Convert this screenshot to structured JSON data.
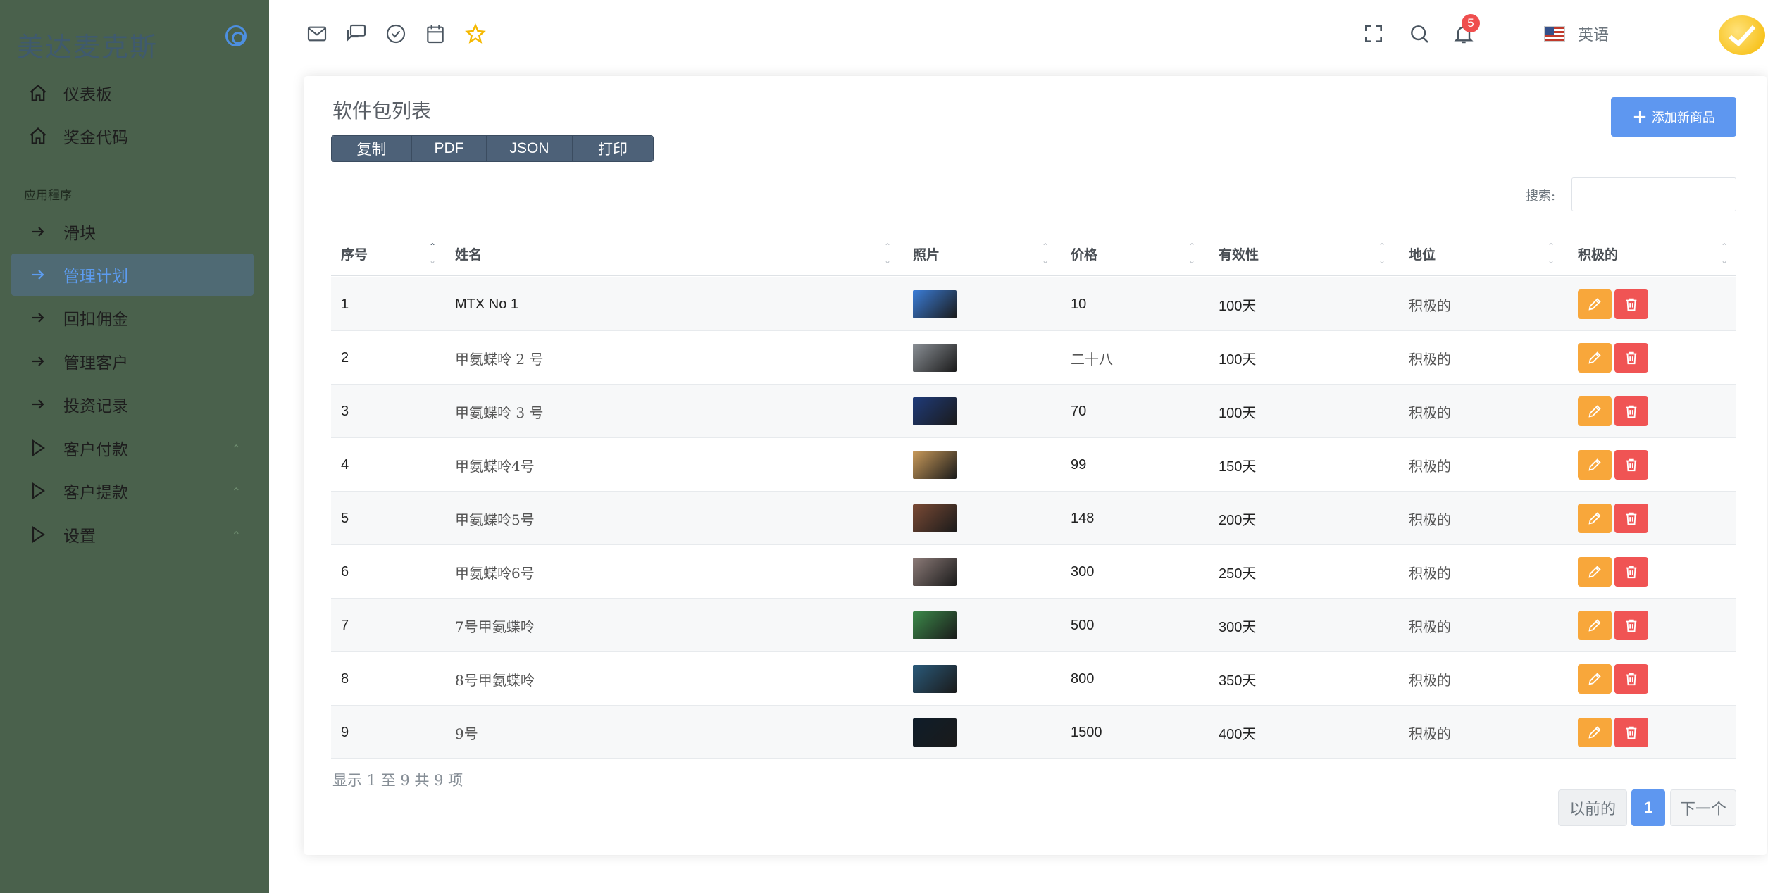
{
  "brand": {
    "name": "美达麦克斯"
  },
  "sidebar": {
    "items_top": [
      {
        "label": "仪表板",
        "icon": "home-icon"
      },
      {
        "label": "奖金代码",
        "icon": "home-icon"
      }
    ],
    "section_label": "应用程序",
    "items": [
      {
        "label": "滑块",
        "icon": "arrow-right-icon"
      },
      {
        "label": "管理计划",
        "icon": "arrow-right-icon",
        "active": true
      },
      {
        "label": "回扣佣金",
        "icon": "arrow-right-icon"
      },
      {
        "label": "管理客户",
        "icon": "arrow-right-icon"
      },
      {
        "label": "投资记录",
        "icon": "arrow-right-icon"
      },
      {
        "label": "客户付款",
        "icon": "play-icon",
        "expandable": true
      },
      {
        "label": "客户提款",
        "icon": "play-icon",
        "expandable": true
      },
      {
        "label": "设置",
        "icon": "play-icon",
        "expandable": true
      }
    ]
  },
  "topbar": {
    "icons": [
      "mail-icon",
      "chat-icon",
      "check-circle-icon",
      "calendar-icon",
      "star-icon"
    ],
    "language": "英语",
    "notification_count": "5"
  },
  "card": {
    "title": "软件包列表",
    "export_buttons": [
      "复制",
      "PDF",
      "JSON",
      "打印"
    ],
    "add_button": "添加新商品",
    "search_label": "搜索:",
    "search_value": ""
  },
  "table": {
    "columns": [
      "序号",
      "姓名",
      "照片",
      "价格",
      "有效性",
      "地位",
      "积极的"
    ],
    "rows": [
      {
        "id": "1",
        "name": "MTX No 1",
        "price": "10",
        "validity": "100天",
        "status": "积极的",
        "thumb_color": "#3b7dd8"
      },
      {
        "id": "2",
        "name": "甲氨蝶呤 2 号",
        "price": "二十八",
        "validity": "100天",
        "status": "积极的",
        "thumb_color": "#8a8f95"
      },
      {
        "id": "3",
        "name": "甲氨蝶呤 3 号",
        "price": "70",
        "validity": "100天",
        "status": "积极的",
        "thumb_color": "#1f3b7a"
      },
      {
        "id": "4",
        "name": "甲氨蝶呤4号",
        "price": "99",
        "validity": "150天",
        "status": "积极的",
        "thumb_color": "#c99a5a"
      },
      {
        "id": "5",
        "name": "甲氨蝶呤5号",
        "price": "148",
        "validity": "200天",
        "status": "积极的",
        "thumb_color": "#7a4a35"
      },
      {
        "id": "6",
        "name": "甲氨蝶呤6号",
        "price": "300",
        "validity": "250天",
        "status": "积极的",
        "thumb_color": "#8c7b78"
      },
      {
        "id": "7",
        "name": "7号甲氨蝶呤",
        "price": "500",
        "validity": "300天",
        "status": "积极的",
        "thumb_color": "#3c8a4a"
      },
      {
        "id": "8",
        "name": "8号甲氨蝶呤",
        "price": "800",
        "validity": "350天",
        "status": "积极的",
        "thumb_color": "#2a5a7a"
      },
      {
        "id": "9",
        "name": "9号",
        "price": "1500",
        "validity": "400天",
        "status": "积极的",
        "thumb_color": "#0f1d2a"
      }
    ]
  },
  "footer": {
    "info": "显示 1 至 9 共 9 项",
    "prev": "以前的",
    "current_page": "1",
    "next": "下一个"
  },
  "colors": {
    "sidebar_bg": "#4a614c",
    "accent": "#5e97f0",
    "edit": "#f8a73b",
    "delete": "#f05454"
  }
}
